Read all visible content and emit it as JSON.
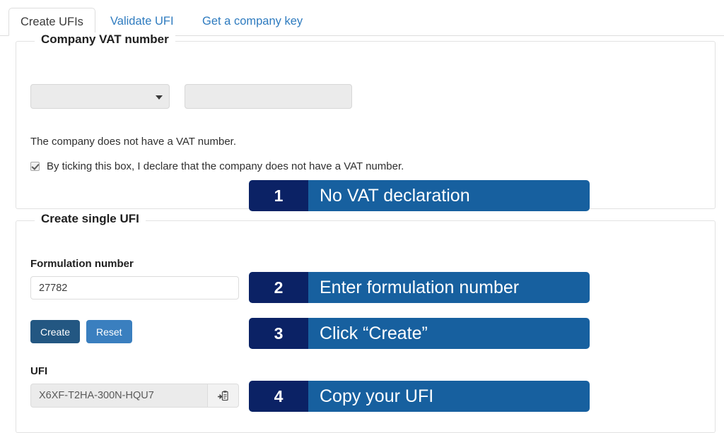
{
  "tabs": [
    {
      "label": "Create UFIs",
      "active": true
    },
    {
      "label": "Validate UFI",
      "active": false
    },
    {
      "label": "Get a company key",
      "active": false
    }
  ],
  "vat_section": {
    "legend": "Company VAT number",
    "country_select": {
      "value": "",
      "caret_icon": "chevron-down-icon"
    },
    "vat_number_input": {
      "value": "",
      "placeholder": ""
    },
    "no_vat_text": "The company does not have a VAT number.",
    "declaration_checkbox": {
      "checked": true,
      "label": "By ticking this box, I declare that the company does not have a VAT number."
    }
  },
  "single_ufi_section": {
    "legend": "Create single UFI",
    "formulation_label": "Formulation number",
    "formulation_input": {
      "value": "27782",
      "placeholder": ""
    },
    "create_button": "Create",
    "reset_button": "Reset",
    "ufi_label": "UFI",
    "ufi_input": {
      "value": "X6XF-T2HA-300N-HQU7",
      "placeholder": ""
    },
    "copy_button_icon": "clipboard-copy-icon"
  },
  "callouts": [
    {
      "number": "1",
      "text": "No VAT declaration"
    },
    {
      "number": "2",
      "text": "Enter formulation number"
    },
    {
      "number": "3",
      "text": "Click “Create”"
    },
    {
      "number": "4",
      "text": "Copy your UFI"
    }
  ],
  "colors": {
    "banner_body": "#17609f",
    "banner_number": "#0b2265",
    "create_button": "#235782",
    "reset_button": "#3a7fbf",
    "tab_link": "#2e7bbf"
  }
}
